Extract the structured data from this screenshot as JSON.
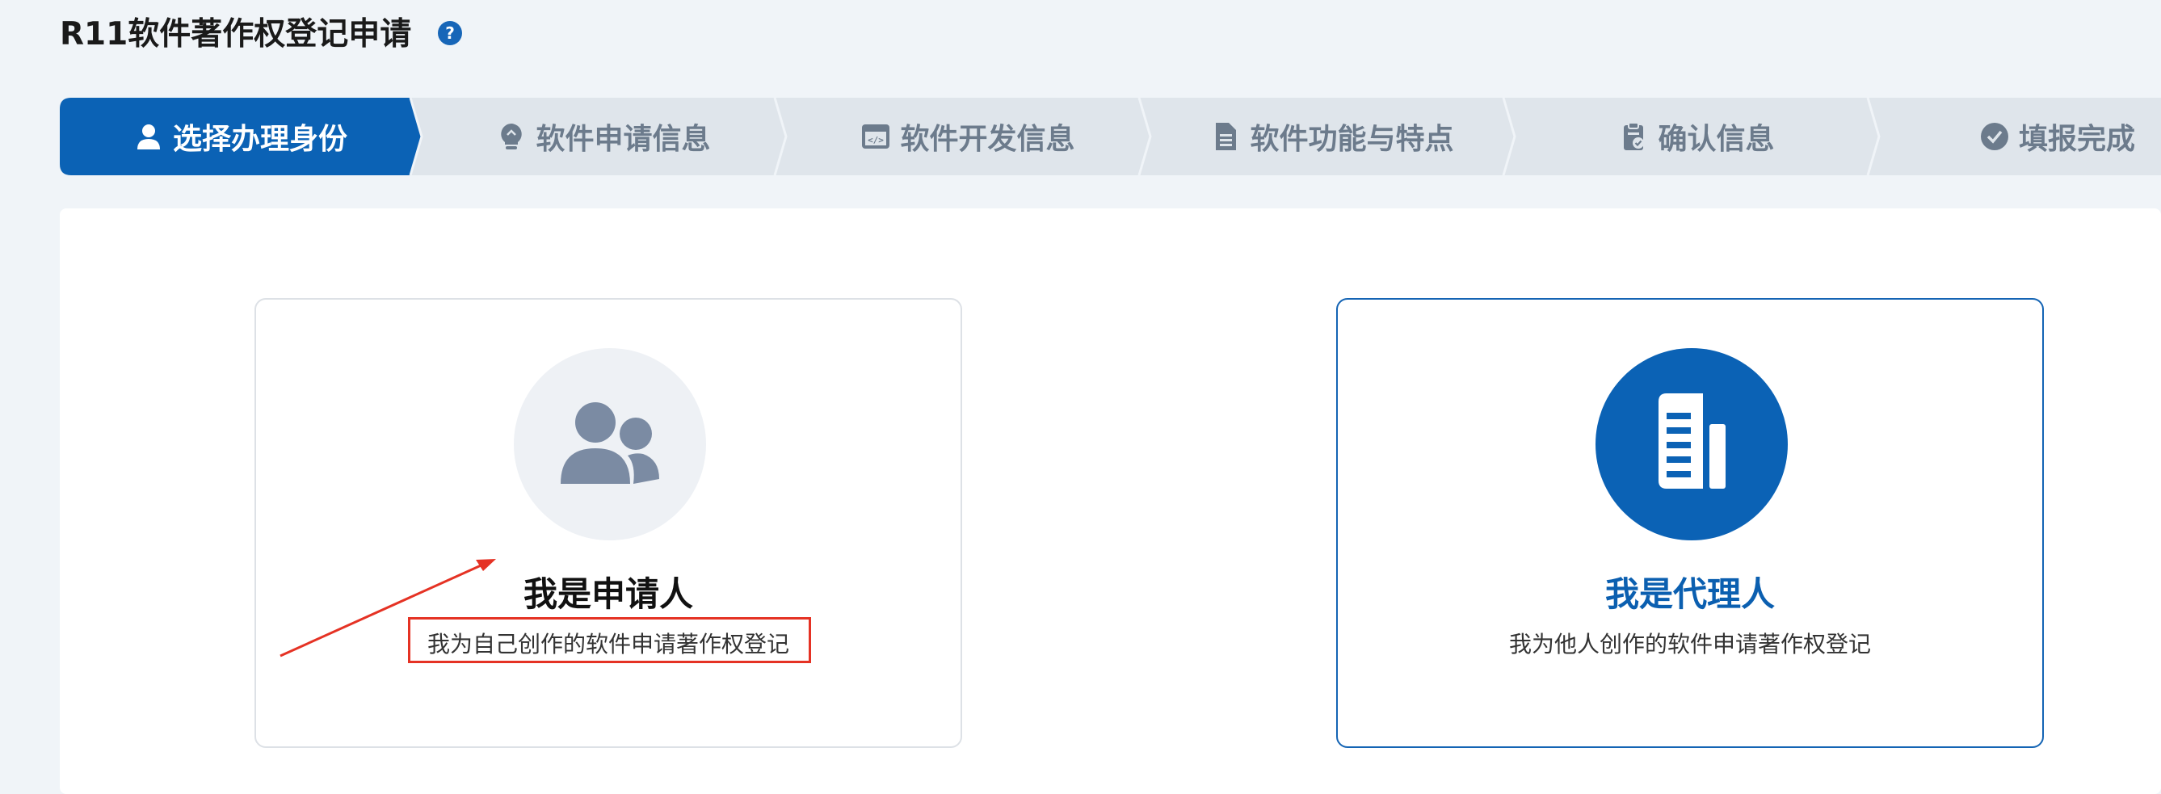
{
  "page": {
    "title": "R11软件著作权登记申请"
  },
  "steps": [
    {
      "label": "选择办理身份",
      "icon": "user-icon",
      "active": true
    },
    {
      "label": "软件申请信息",
      "icon": "lightbulb-icon",
      "active": false
    },
    {
      "label": "软件开发信息",
      "icon": "code-window-icon",
      "active": false
    },
    {
      "label": "软件功能与特点",
      "icon": "document-icon",
      "active": false
    },
    {
      "label": "确认信息",
      "icon": "clipboard-check-icon",
      "active": false
    },
    {
      "label": "填报完成",
      "icon": "check-circle-icon",
      "active": false
    }
  ],
  "cards": {
    "applicant": {
      "title": "我是申请人",
      "desc": "我为自己创作的软件申请著作权登记",
      "icon": "users-icon"
    },
    "agent": {
      "title": "我是代理人",
      "desc": "我为他人创作的软件申请著作权登记",
      "icon": "building-icon",
      "selected": true
    }
  },
  "colors": {
    "primary": "#0b62b5",
    "step_inactive_bg": "#dfe5eb",
    "step_inactive_text": "#6c7b8c",
    "annotation": "#e53224"
  }
}
